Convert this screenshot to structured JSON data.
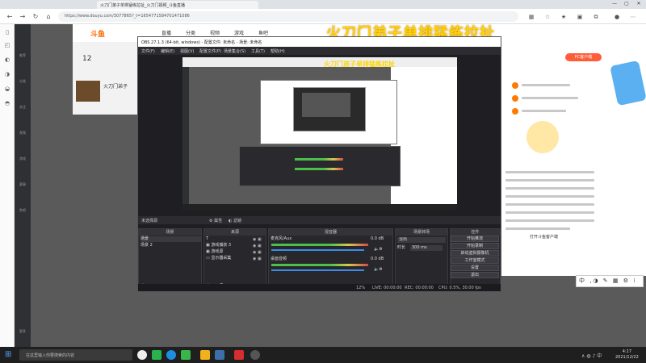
{
  "browser": {
    "tab_title": "火刀门弟子单排猛练拉扯_火刀门视频_斗鱼直播",
    "url": "https://www.douyu.com/3077865?_t=1654771584701471086",
    "win_buttons": [
      "—",
      "▢",
      "✕"
    ]
  },
  "site": {
    "logo": "斗鱼",
    "menu": [
      "直播",
      "分类",
      "视频",
      "游戏",
      "鱼吧"
    ],
    "follow_count": "12",
    "stream_title_short": "火刀门弟子",
    "pc_client_label": "PC客户端",
    "side_items": [
      "推荐",
      "分类",
      "关注",
      "视频",
      "游戏",
      "赛事",
      "鱼吧",
      "更多"
    ],
    "bottom_link": "打开斗鱼客户端"
  },
  "overlay_title": "火刀门弟子单排猛练拉扯",
  "obs": {
    "title": "OBS 27.1.3 (64-bit, windows) - 配置文件: 未命名 - 场景: 未命名",
    "menu": [
      "文件(F)",
      "编辑(E)",
      "视图(V)",
      "配置文件(P)",
      "场景集合(S)",
      "工具(T)",
      "帮助(H)"
    ],
    "source_header": "未选择源",
    "props_label": "属性",
    "filters_label": "滤镜",
    "docks": {
      "scenes": {
        "title": "场景",
        "items": [
          "场景",
          "场景 2"
        ]
      },
      "sources": {
        "title": "来源",
        "items": [
          "T",
          "游戏捕获 3",
          "游戏源",
          "显示器采集"
        ]
      },
      "mixer": {
        "title": "混音器",
        "channels": [
          {
            "name": "麦克风/Aux",
            "db": "0.0 dB"
          },
          {
            "name": "桌面音频",
            "db": "0.0 dB"
          }
        ]
      },
      "transitions": {
        "title": "场景转场",
        "type": "淡出",
        "duration_label": "时长",
        "duration": "300 ms"
      },
      "controls": {
        "title": "控件",
        "buttons": [
          "开始推流",
          "开始录制",
          "启动虚拟摄像机",
          "工作室模式",
          "设置",
          "退出"
        ]
      }
    },
    "status": {
      "live": "LIVE: 00:00:00",
      "rec": "REC: 00:00:00",
      "cpu": "CPU: 0.5%, 30.00 fps",
      "dropped": "12%"
    }
  },
  "taskbar": {
    "search_placeholder": "在这里输入你要搜索的内容",
    "time": "4:17",
    "date": "2021/12/22"
  },
  "ime": "中 ,◑ ✎ ▦ ⚙ ⁞"
}
